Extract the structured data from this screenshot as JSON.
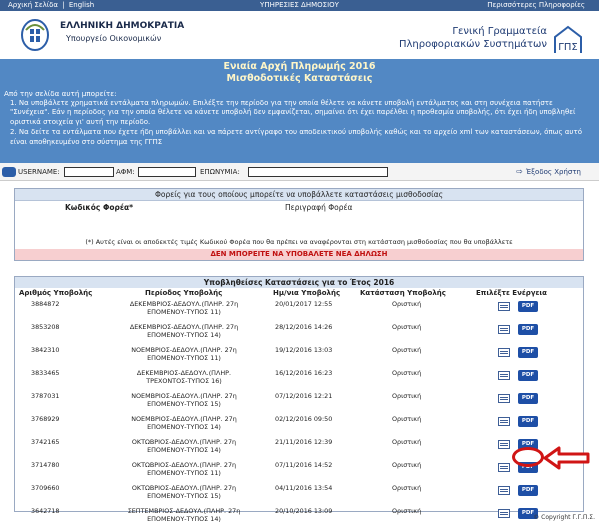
{
  "topbar": {
    "home": "Αρχική Σελίδα",
    "english": "English",
    "center": "ΥΠΗΡΕΣΙΕΣ ΔΗΜΟΣΙΟΥ",
    "right": "Περισσότερες Πληροφορίες"
  },
  "header": {
    "gov": "ΕΛΛΗΝΙΚΗ ΔΗΜΟΚΡΑΤΙΑ",
    "ministry": "Υπουργείο Οικονομικών",
    "gsis_line1": "Γενική Γραμματεία",
    "gsis_line2": "Πληροφοριακών Συστημάτων",
    "logo_text": "ΓΠΣ"
  },
  "banner": {
    "title1": "Ενιαία Αρχή Πληρωμής 2016",
    "title2": "Μισθοδοτικές Καταστάσεις",
    "intro": "Από την σελίδα αυτή μπορείτε:",
    "item1": "1. Να υποβάλετε χρηματικά εντάλματα πληρωμών. Επιλέξτε την περίοδο για την οποία θέλετε να κάνετε υποβολή εντάλματος και στη συνέχεια πατήστε \"Συνέχεια\". Εάν η περίοδος για την οποία θέλετε να κάνετε υποβολή δεν εμφανίζεται, σημαίνει ότι έχει παρέλθει η προθεσμία υποβολής, ότι έχει ήδη υποβληθεί οριστικά στοιχεία γι' αυτή την περίοδο.",
    "item2": "2. Να δείτε τα εντάλματα που έχετε ήδη υποβάλλει και να πάρετε αντίγραφο του αποδεικτικού υποβολής καθώς και το αρχείο xml των καταστάσεων, όπως αυτό είναι αποθηκευμένο στο σύστημα της ΓΓΠΣ"
  },
  "userbar": {
    "username_label": "USERNAME:",
    "afm_label": "ΑΦΜ:",
    "eponymia_label": "ΕΠΩΝΥΜΙΑ:",
    "exit": "Έξοδος Χρήστη",
    "exit_icon": "exit-icon"
  },
  "bodies_panel": {
    "title": "Φορείς για τους οποίους μπορείτε να υποβάλλετε καταστάσεις μισθοδοσίας",
    "col_code": "Κωδικός Φορέα*",
    "col_desc": "Περιγραφή Φορέα",
    "note": "(*) Αυτές είναι οι αποδεκτές τιμές Κωδικού Φορέα που θα πρέπει να αναφέρονται στη κατάσταση μισθοδοσίας που θα υποβάλλετε",
    "warning": "ΔΕΝ ΜΠΟΡΕΙΤΕ ΝΑ ΥΠΟΒΑΛΕΤΕ ΝΕΑ ΔΗΛΩΣΗ"
  },
  "submissions": {
    "title": "Υποβληθείσες Καταστάσεις για το Έτος 2016",
    "col_num": "Αριθμός Υποβολής",
    "col_period": "Περίοδος Υποβολής",
    "col_date": "Ημ/νια Υποβολής",
    "col_status": "Κατάσταση Υποβολής",
    "col_action": "Επιλέξτε Ενέργεια",
    "pdf_label": "PDF",
    "rows": [
      {
        "num": "3884872",
        "period1": "ΔΕΚΕΜΒΡΙΟΣ-ΔΕΔΟΥΛ.(ΠΛΗΡ. 27η",
        "period2": "ΕΠΟΜΕΝΟΥ-ΤΥΠΟΣ 11)",
        "date": "20/01/2017 12:55",
        "status": "Οριστική"
      },
      {
        "num": "3853208",
        "period1": "ΔΕΚΕΜΒΡΙΟΣ-ΔΕΔΟΥΛ.(ΠΛΗΡ. 27η",
        "period2": "ΕΠΟΜΕΝΟΥ-ΤΥΠΟΣ 14)",
        "date": "28/12/2016 14:26",
        "status": "Οριστική"
      },
      {
        "num": "3842310",
        "period1": "ΝΟΕΜΒΡΙΟΣ-ΔΕΔΟΥΛ.(ΠΛΗΡ. 27η",
        "period2": "ΕΠΟΜΕΝΟΥ-ΤΥΠΟΣ 11)",
        "date": "19/12/2016 13:03",
        "status": "Οριστική"
      },
      {
        "num": "3833465",
        "period1": "ΔΕΚΕΜΒΡΙΟΣ-ΔΕΔΟΥΛ.(ΠΛΗΡ.",
        "period2": "ΤΡΕΧΟΝΤΟΣ-ΤΥΠΟΣ 16)",
        "date": "16/12/2016 16:23",
        "status": "Οριστική"
      },
      {
        "num": "3787031",
        "period1": "ΝΟΕΜΒΡΙΟΣ-ΔΕΔΟΥΛ.(ΠΛΗΡ. 27η",
        "period2": "ΕΠΟΜΕΝΟΥ-ΤΥΠΟΣ 15)",
        "date": "07/12/2016 12:21",
        "status": "Οριστική"
      },
      {
        "num": "3768929",
        "period1": "ΝΟΕΜΒΡΙΟΣ-ΔΕΔΟΥΛ.(ΠΛΗΡ. 27η",
        "period2": "ΕΠΟΜΕΝΟΥ-ΤΥΠΟΣ 14)",
        "date": "02/12/2016 09:50",
        "status": "Οριστική"
      },
      {
        "num": "3742165",
        "period1": "ΟΚΤΩΒΡΙΟΣ-ΔΕΔΟΥΛ.(ΠΛΗΡ. 27η",
        "period2": "ΕΠΟΜΕΝΟΥ-ΤΥΠΟΣ 14)",
        "date": "21/11/2016 12:39",
        "status": "Οριστική"
      },
      {
        "num": "3714780",
        "period1": "ΟΚΤΩΒΡΙΟΣ-ΔΕΔΟΥΛ.(ΠΛΗΡ. 27η",
        "period2": "ΕΠΟΜΕΝΟΥ-ΤΥΠΟΣ 11)",
        "date": "07/11/2016 14:52",
        "status": "Οριστική"
      },
      {
        "num": "3709660",
        "period1": "ΟΚΤΩΒΡΙΟΣ-ΔΕΔΟΥΛ.(ΠΛΗΡ. 27η",
        "period2": "ΕΠΟΜΕΝΟΥ-ΤΥΠΟΣ 15)",
        "date": "04/11/2016 13:54",
        "status": "Οριστική"
      },
      {
        "num": "3642718",
        "period1": "ΣΕΠΤΕΜΒΡΙΟΣ-ΔΕΔΟΥΛ.(ΠΛΗΡ. 27η",
        "period2": "ΕΠΟΜΕΝΟΥ-ΤΥΠΟΣ 14)",
        "date": "20/10/2016 13:09",
        "status": "Οριστική"
      }
    ]
  },
  "footer": {
    "copyright": "© Copyright Γ.Γ.Π.Σ."
  },
  "colors": {
    "topbar": "#3a5f92",
    "banner": "#5288c4",
    "banner_title": "#fff6c8",
    "warning_bg": "#f7cfd0",
    "warning_text": "#c01010",
    "pdf_button": "#1e4fa6",
    "highlight": "#d01515"
  }
}
